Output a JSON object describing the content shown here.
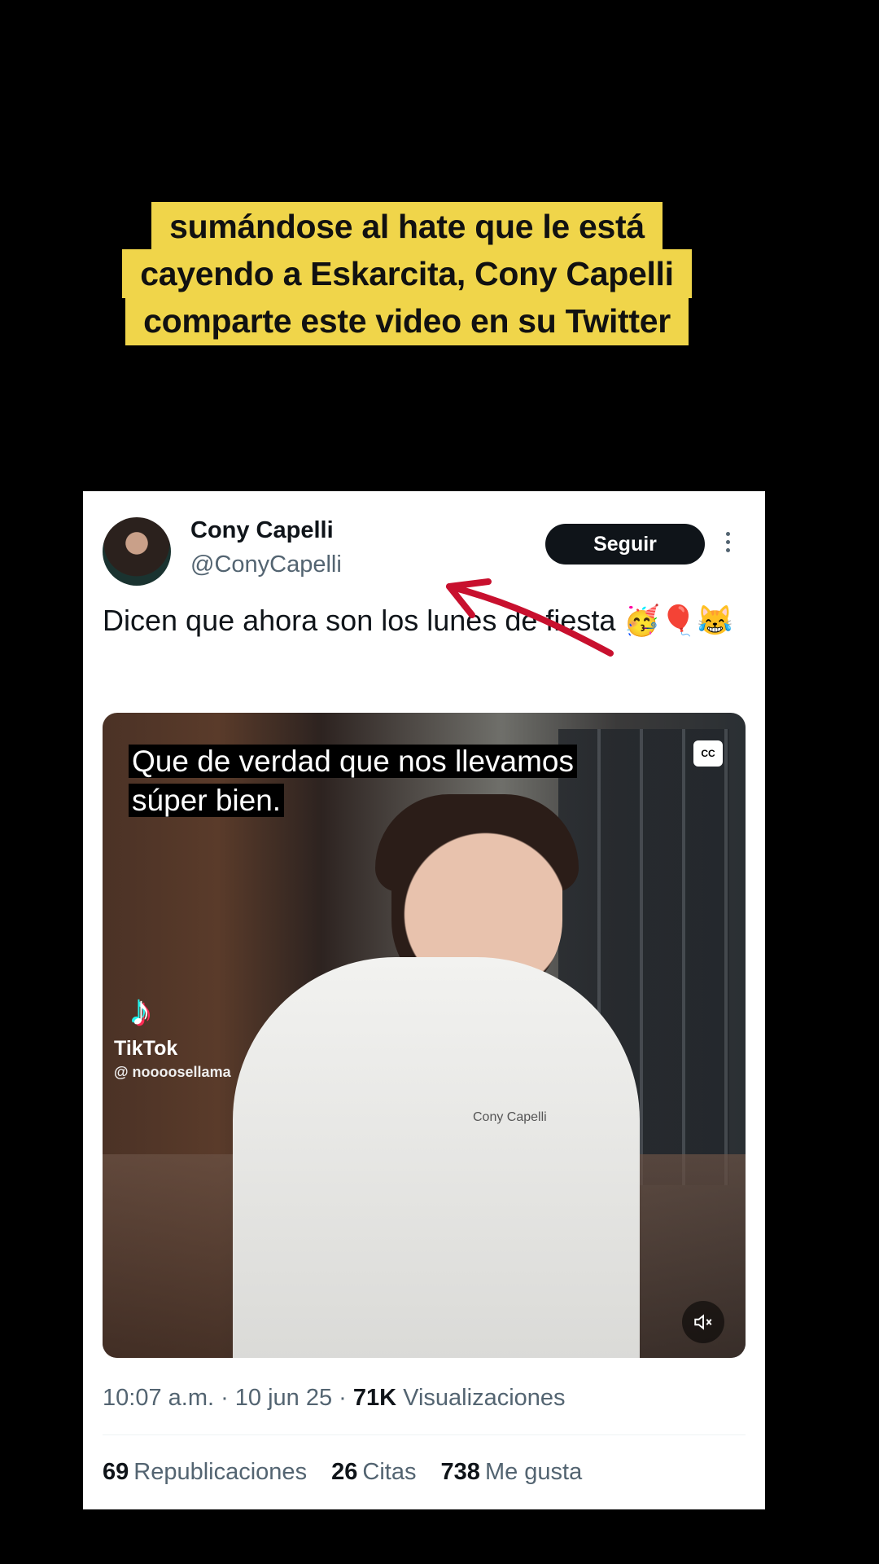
{
  "caption": {
    "line1": "sumándose al hate que le está",
    "line2": "cayendo a Eskarcita, Cony Capelli",
    "line3": "comparte este video en su Twitter"
  },
  "tweet": {
    "author_name": "Cony Capelli",
    "handle": "@ConyCapelli",
    "follow_label": "Seguir",
    "text": "Dicen que ahora son los lunes de fiesta 🥳🎈😹",
    "timestamp": "10:07 a.m. · 10 jun 25 · ",
    "views_count": "71K",
    "views_label": " Visualizaciones",
    "reposts_count": "69",
    "reposts_label": "Republicaciones",
    "quotes_count": "26",
    "quotes_label": "Citas",
    "likes_count": "738",
    "likes_label": "Me gusta"
  },
  "video": {
    "subtitle_line1": "Que de verdad que nos llevamos",
    "subtitle_line2": "súper bien.",
    "cc_label": "CC",
    "tiktok_name": "TikTok",
    "tiktok_user": "@ noooosellama",
    "jacket_text": "Cony Capelli"
  },
  "icons": [
    "more-icon",
    "cc-icon",
    "tiktok-logo-icon",
    "volume-icon",
    "arrow-annotation"
  ],
  "colors": {
    "caption_bg": "#f0d54a",
    "follow_bg": "#0f1419",
    "arrow": "#c8102e"
  }
}
